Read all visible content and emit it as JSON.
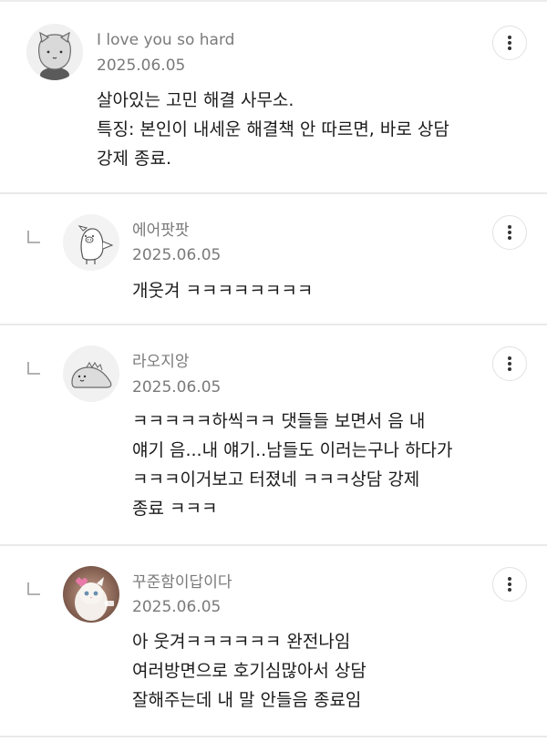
{
  "comments": [
    {
      "author": "I love you so hard",
      "date": "2025.06.05",
      "lines": [
        "살아있는 고민 해결 사무소.",
        "특징: 본인이 내세운 해결책 안 따르면, 바로 상담",
        "강제 종료."
      ],
      "is_reply": false,
      "avatar": "cat-face-avatar"
    },
    {
      "author": "에어팟팟",
      "date": "2025.06.05",
      "lines": [
        "개웃겨 ㅋㅋㅋㅋㅋㅋㅋㅋ"
      ],
      "is_reply": true,
      "avatar": "pig-doodle-avatar"
    },
    {
      "author": "라오지앙",
      "date": "2025.06.05",
      "lines": [
        "ㅋㅋㅋㅋㅋ하씩ㅋㅋ 댓들들 보면서 음 내",
        "얘기 음...내 얘기..남들도 이러는구나 하다가",
        "ㅋㅋㅋ이거보고 터졌네 ㅋㅋㅋ상담 강제",
        "종료 ㅋㅋㅋ"
      ],
      "is_reply": true,
      "avatar": "dinosaur-doodle-avatar"
    },
    {
      "author": "꾸준함이답이다",
      "date": "2025.06.05",
      "lines": [
        "아 웃겨ㅋㅋㅋㅋㅋㅋ 완전나임",
        "여러방면으로 호기심많아서 상담",
        "잘해주는데 내 말 안들음 종료임"
      ],
      "is_reply": true,
      "avatar": "white-cat-photo-avatar"
    }
  ],
  "icons": {
    "more": "more-vertical-icon",
    "reply": "reply-arrow-icon"
  },
  "colors": {
    "meta_text": "#7a7a7a",
    "body_text": "#1b1b1b",
    "divider": "#e9e9e9"
  }
}
